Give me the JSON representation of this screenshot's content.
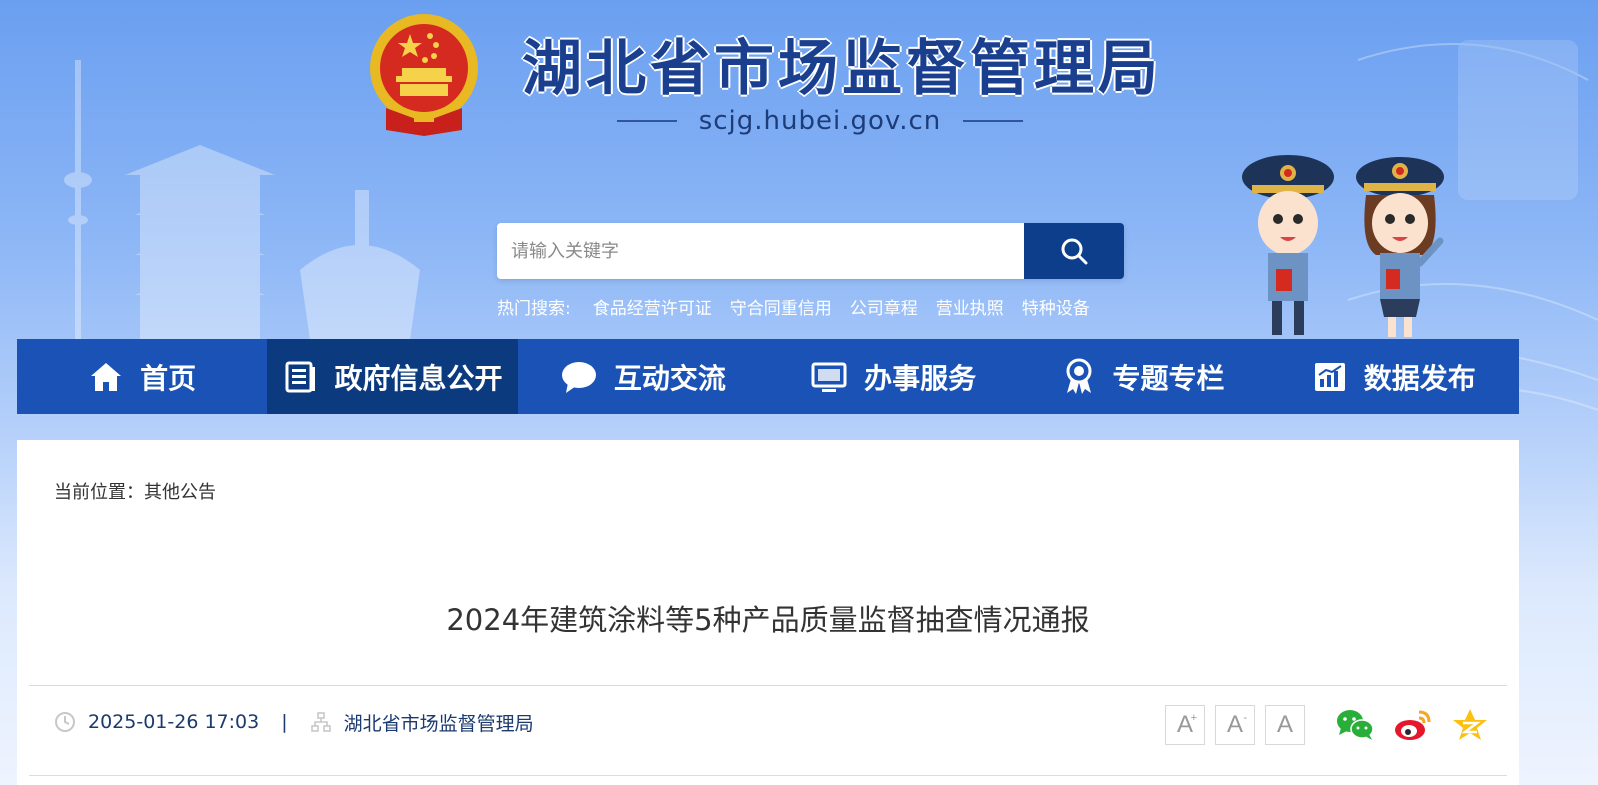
{
  "header": {
    "site_title": "湖北省市场监督管理局",
    "site_domain": "scjg.hubei.gov.cn"
  },
  "search": {
    "placeholder": "请输入关键字",
    "hot_label": "热门搜索:",
    "hot_terms": [
      "食品经营许可证",
      "守合同重信用",
      "公司章程",
      "营业执照",
      "特种设备"
    ]
  },
  "nav": {
    "items": [
      {
        "label": "首页",
        "icon": "home-icon"
      },
      {
        "label": "政府信息公开",
        "icon": "document-list-icon",
        "active": true
      },
      {
        "label": "互动交流",
        "icon": "chat-bubble-icon"
      },
      {
        "label": "办事服务",
        "icon": "monitor-icon"
      },
      {
        "label": "专题专栏",
        "icon": "award-ribbon-icon"
      },
      {
        "label": "数据发布",
        "icon": "bar-chart-icon"
      }
    ]
  },
  "breadcrumb": "当前位置：其他公告",
  "article": {
    "title": "2024年建筑涂料等5种产品质量监督抽查情况通报",
    "date": "2025-01-26 17:03",
    "separator": "|",
    "source": "湖北省市场监督管理局"
  },
  "font_size_controls": [
    "A",
    "A",
    "A"
  ],
  "share_icons": [
    "wechat-icon",
    "weibo-icon",
    "qzone-icon"
  ],
  "colors": {
    "nav_bg": "#1a53b5",
    "nav_active": "#0b3a7e",
    "search_button": "#0d3e8c",
    "title_color": "#1a3f8f"
  }
}
